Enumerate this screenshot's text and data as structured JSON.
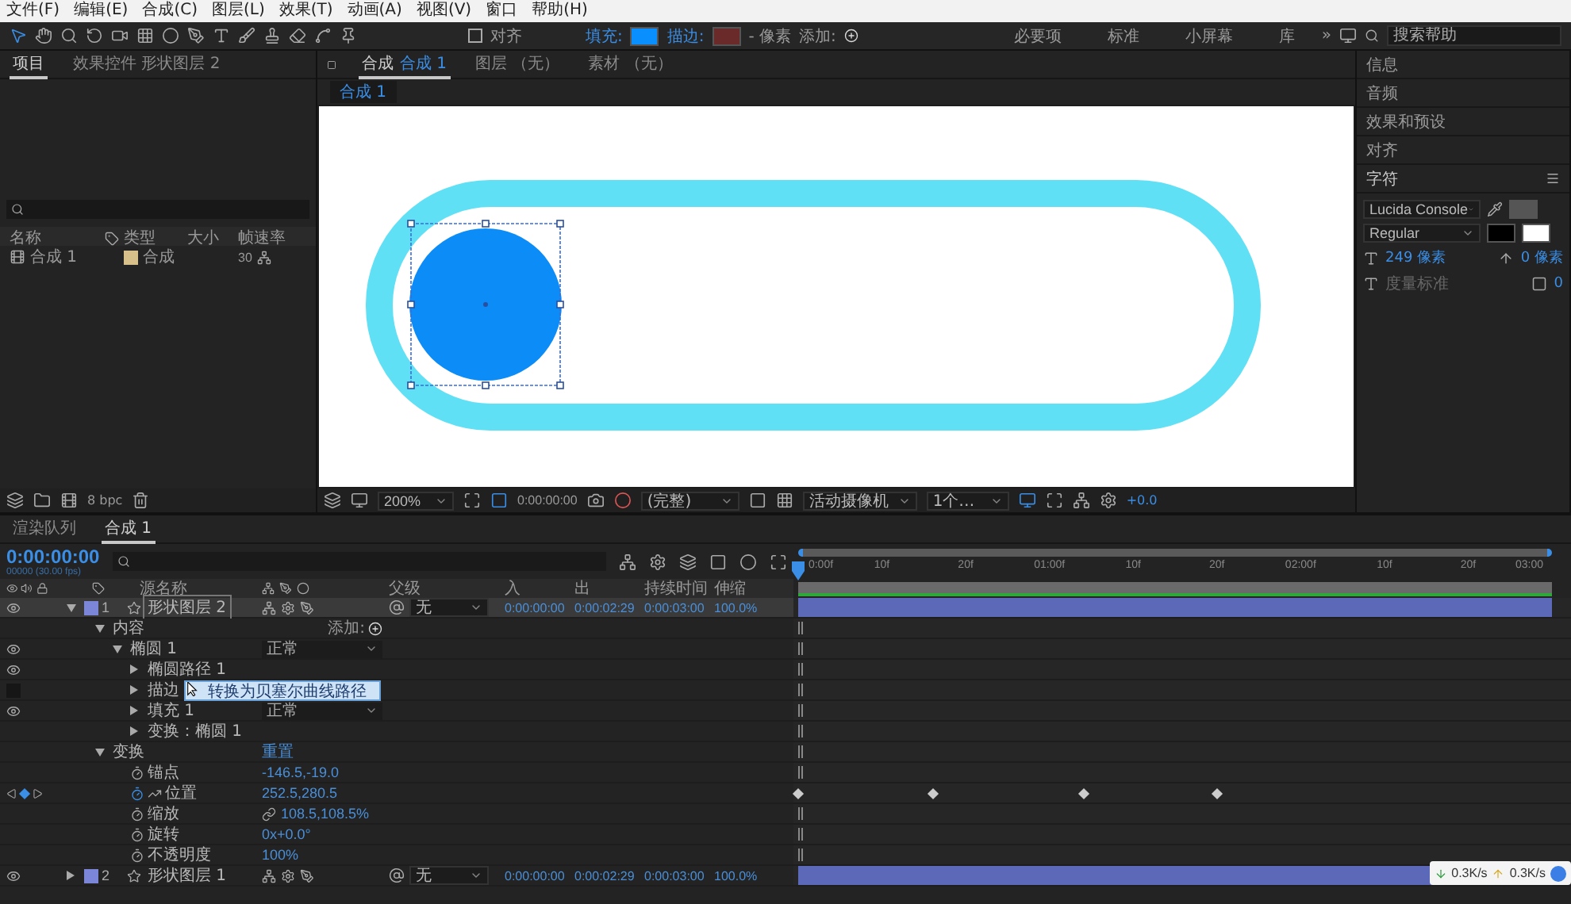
{
  "menu": [
    "文件(F)",
    "编辑(E)",
    "合成(C)",
    "图层(L)",
    "效果(T)",
    "动画(A)",
    "视图(V)",
    "窗口",
    "帮助(H)"
  ],
  "toolbar": {
    "align_label": "对齐",
    "align_checked": false,
    "fill_label": "填充:",
    "stroke_label": "描边:",
    "stroke_width": "- 像素",
    "add_label": "添加:",
    "workspaces": [
      {
        "label": "必要项",
        "selected": false
      },
      {
        "label": "标准",
        "selected": false
      },
      {
        "label": "小屏幕",
        "selected": false
      },
      {
        "label": "库",
        "selected": false
      }
    ],
    "more": "»",
    "search_placeholder": "搜索帮助"
  },
  "project_panel": {
    "tabs": [
      {
        "label": "项目",
        "selected": true
      },
      {
        "label": "效果控件 形状图层 2",
        "selected": false
      }
    ],
    "columns": [
      "名称",
      "类型",
      "大小",
      "帧速率"
    ],
    "rows": [
      {
        "name": "合成 1",
        "type": "合成",
        "fps": "30"
      }
    ],
    "bpc": "8 bpc"
  },
  "viewer": {
    "tabs": [
      {
        "prefix": "合成",
        "label": "合成 1",
        "selected": true
      },
      {
        "prefix": "图层",
        "label": "（无）",
        "selected": false
      },
      {
        "prefix": "素材",
        "label": "（无）",
        "selected": false
      }
    ],
    "breadcrumb": "合成 1",
    "zoom": "200%",
    "timecode": "0:00:00:00",
    "resolution": "(完整)",
    "camera": "活动摄像机",
    "views": "1个…",
    "exposure": "+0.0"
  },
  "right_panel": {
    "sections": [
      "信息",
      "音频",
      "效果和预设",
      "对齐"
    ],
    "character": {
      "title": "字符",
      "font": "Lucida Console",
      "style": "Regular",
      "size": "249 像素",
      "leading": "0 像素",
      "kerning": "度量标准",
      "tracking": "0"
    }
  },
  "timeline": {
    "tabs": [
      {
        "label": "渲染队列",
        "selected": false
      },
      {
        "label": "合成 1",
        "selected": true
      }
    ],
    "timecode": "0:00:00:00",
    "frame_info": "00000 (30.00 fps)",
    "columns": [
      "源名称",
      "父级",
      "入",
      "出",
      "持续时间",
      "伸缩"
    ],
    "ruler": [
      "0:00f",
      "10f",
      "20f",
      "01:00f",
      "10f",
      "20f",
      "02:00f",
      "10f",
      "20f",
      "03:00"
    ],
    "playhead": {
      "level": 0
    },
    "layers": [
      {
        "kind": "layer",
        "index": "1",
        "name": "形状图层 2",
        "expanded": true,
        "selected": true,
        "eye": true,
        "parent": "无",
        "in": "0:00:00:00",
        "out": "0:00:02:29",
        "duration": "0:00:03:00",
        "stretch": "100.0%",
        "children": [
          {
            "kind": "group",
            "name": "内容",
            "expanded": true,
            "action": "添加:",
            "children": [
              {
                "kind": "group",
                "name": "椭圆 1",
                "expanded": true,
                "eye": true,
                "mode": "正常",
                "children": [
                  {
                    "kind": "group",
                    "name": "椭圆路径 1",
                    "expanded": false,
                    "eye": true
                  },
                  {
                    "kind": "group",
                    "name": "描边",
                    "expanded": false,
                    "eye": false
                  },
                  {
                    "kind": "group",
                    "name": "填充 1",
                    "expanded": false,
                    "eye": true,
                    "mode": "正常"
                  },
                  {
                    "kind": "group",
                    "name": "变换：椭圆 1",
                    "expanded": false
                  }
                ]
              }
            ]
          },
          {
            "kind": "group",
            "name": "变换",
            "expanded": true,
            "value": "重置",
            "children": [
              {
                "kind": "property",
                "name": "锚点",
                "value": "-146.5,-19.0",
                "keyframed": false
              },
              {
                "kind": "property",
                "name": "位置",
                "value": "252.5,280.5",
                "keyframed": true,
                "keyframes": [
                  {
                    "level": 0
                  },
                  {
                    "level": 0.178
                  },
                  {
                    "level": 0.378
                  },
                  {
                    "level": 0.556
                  }
                ]
              },
              {
                "kind": "property",
                "name": "缩放",
                "value": "108.5,108.5%",
                "keyframed": false,
                "linked": true
              },
              {
                "kind": "property",
                "name": "旋转",
                "value": "0x+0.0°",
                "keyframed": false
              },
              {
                "kind": "property",
                "name": "不透明度",
                "value": "100%",
                "keyframed": false
              }
            ]
          }
        ]
      },
      {
        "kind": "layer",
        "index": "2",
        "name": "形状图层 1",
        "expanded": false,
        "selected": false,
        "eye": true,
        "parent": "无",
        "in": "0:00:00:00",
        "out": "0:00:02:29",
        "duration": "0:00:03:00",
        "stretch": "100.0%"
      }
    ],
    "context_menu": {
      "items": [
        "转换为贝塞尔曲线路径"
      ]
    }
  },
  "network": {
    "down": "0.3K/s",
    "up": "0.3K/s"
  }
}
